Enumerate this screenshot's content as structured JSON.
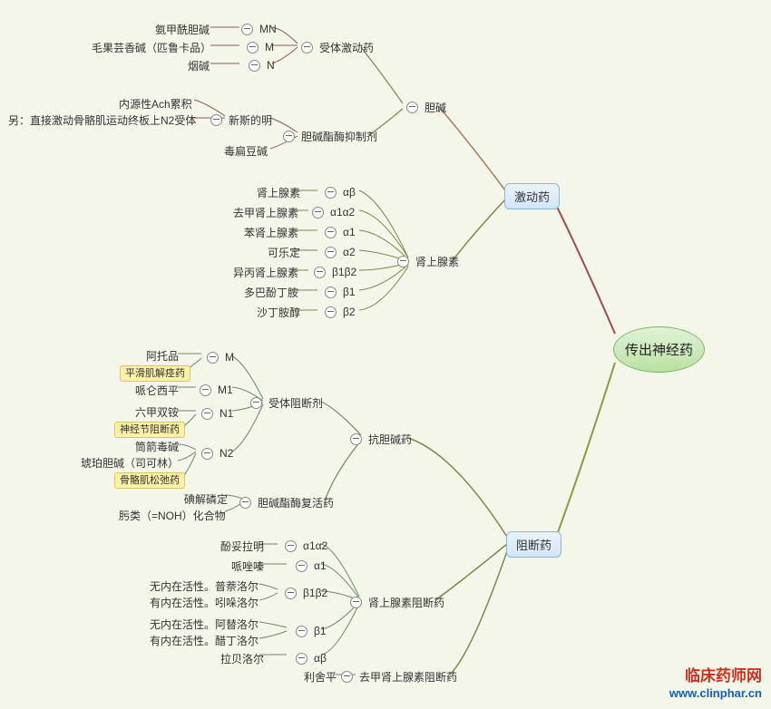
{
  "root": {
    "text": "传出神经药"
  },
  "level1": {
    "agonist": "激动药",
    "antagonist": "阻断药"
  },
  "agonist": {
    "choline": "胆碱",
    "choline_sub": {
      "receptor_agonist": "受体激动药",
      "ra_items": {
        "mn": "MN",
        "mn_drug": "氨甲酰胆碱",
        "m": "M",
        "m_drug": "毛果芸香碱（匹鲁卡品）",
        "n": "N",
        "n_drug": "烟碱"
      },
      "ache_inhibitor": "胆碱酯酶抑制剂",
      "ai_items": {
        "neo": "新斯的明",
        "neo_notes": {
          "a": "内源性Ach累积",
          "b": "另：直接激动骨骼肌运动终板上N2受体"
        },
        "phy": "毒扁豆碱"
      }
    },
    "adren": "肾上腺素",
    "adren_items": {
      "ab": {
        "r": "αβ",
        "d": "肾上腺素"
      },
      "a1a2": {
        "r": "α1α2",
        "d": "去甲肾上腺素"
      },
      "a1": {
        "r": "α1",
        "d": "苯肾上腺素"
      },
      "a2": {
        "r": "α2",
        "d": "可乐定"
      },
      "b1b2": {
        "r": "β1β2",
        "d": "异丙肾上腺素"
      },
      "b1": {
        "r": "β1",
        "d": "多巴酚丁胺"
      },
      "b2": {
        "r": "β2",
        "d": "沙丁胺醇"
      }
    }
  },
  "antagonist": {
    "anticholine": "抗胆碱药",
    "ac_sub": {
      "receptor_blocker": "受体阻断剂",
      "rb_items": {
        "m": {
          "r": "M",
          "d": "阿托品",
          "tag": "平滑肌解痉药"
        },
        "m1": {
          "r": "M1",
          "d": "哌仑西平"
        },
        "n1": {
          "r": "N1",
          "d": "六甲双铵",
          "tag": "神经节阻断药"
        },
        "n2": {
          "r": "N2",
          "d1": "筒箭毒碱",
          "d2": "琥珀胆碱（司可林）",
          "tag": "骨骼肌松弛药"
        }
      },
      "ache_react": "胆碱酯酶复活药",
      "ar_items": {
        "a": "碘解磷定",
        "b": "肟类（=NOH）化合物"
      }
    },
    "adren_block": "肾上腺素阻断药",
    "ab_items": {
      "a1a2": {
        "r": "α1α2",
        "d": "酚妥拉明"
      },
      "a1": {
        "r": "α1",
        "d": "哌唑嗪"
      },
      "b1b2": {
        "r": "β1β2",
        "d1": "无内在活性。普萘洛尔",
        "d2": "有内在活性。吲哚洛尔"
      },
      "b1": {
        "r": "β1",
        "d1": "无内在活性。阿替洛尔",
        "d2": "有内在活性。醋丁洛尔"
      },
      "ab": {
        "r": "αβ",
        "d": "拉贝洛尔"
      }
    },
    "ne_block": "去甲肾上腺素阻断药",
    "ne_drug": "利舍平"
  },
  "watermark": {
    "line1": "临床药师网",
    "line2": "www.clinphar.cn"
  }
}
